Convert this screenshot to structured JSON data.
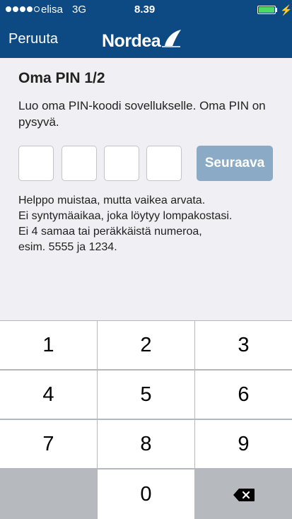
{
  "status_bar": {
    "carrier": "elisa",
    "network": "3G",
    "time": "8.39",
    "battery_level": 1.0
  },
  "nav": {
    "cancel_label": "Peruuta",
    "logo_text": "Nordea"
  },
  "main": {
    "title": "Oma PIN 1/2",
    "intro": "Luo oma PIN-koodi sovellukselle. Oma PIN on pysyvä.",
    "next_label": "Seuraava",
    "hint_lines": [
      "Helppo muistaa, mutta vaikea arvata.",
      "Ei syntymäaikaa, joka löytyy lompakostasi.",
      "Ei 4 samaa tai peräkkäistä numeroa,",
      "esim. 5555 ja 1234."
    ]
  },
  "keypad": {
    "keys": [
      "1",
      "2",
      "3",
      "4",
      "5",
      "6",
      "7",
      "8",
      "9",
      "0"
    ],
    "delete_icon": "backspace-icon"
  },
  "colors": {
    "header_bg": "#0d4a84",
    "button_bg": "#8aaac5",
    "battery": "#4cd964"
  }
}
